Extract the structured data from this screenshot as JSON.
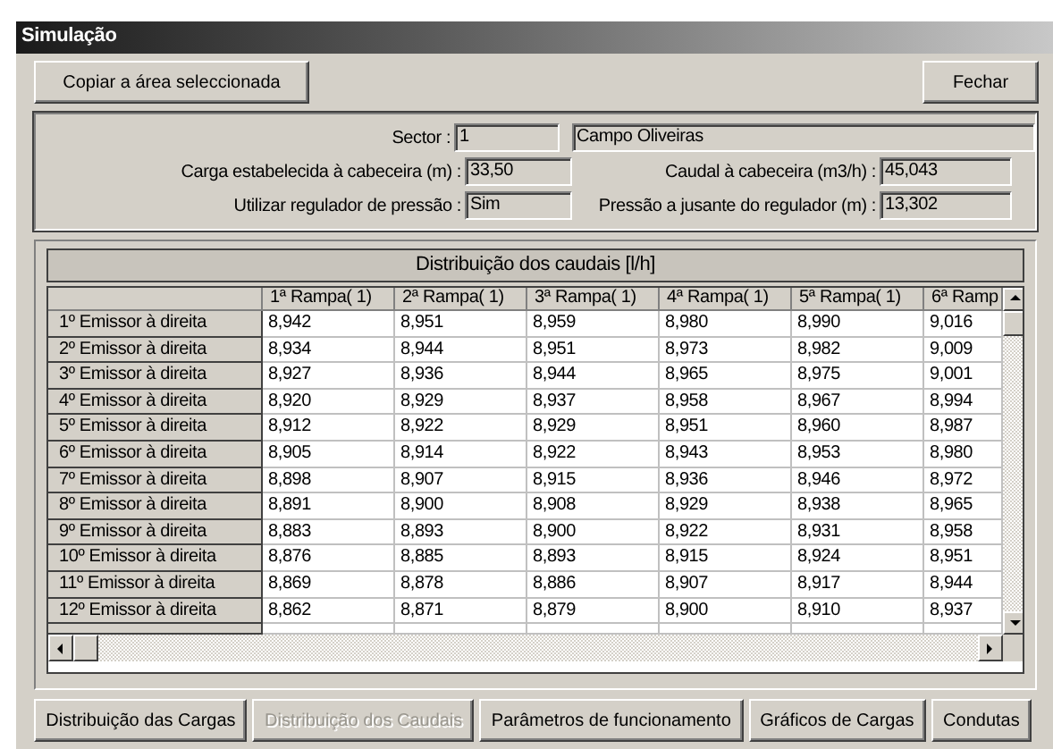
{
  "window": {
    "title": "Simulação"
  },
  "top_buttons": [
    {
      "label": "Copiar a área seleccionada"
    },
    {
      "label": "Fechar"
    }
  ],
  "info": {
    "sector_label": "Sector :",
    "sector_value": "1",
    "sector_name": "Campo Oliveiras",
    "left": [
      {
        "label": "Carga estabelecida à cabeceira (m) :",
        "value": "33,50"
      },
      {
        "label": "Utilizar regulador de pressão :",
        "value": "Sim"
      }
    ],
    "right": [
      {
        "label": "Caudal à cabeceira (m3/h) :",
        "value": "45,043"
      },
      {
        "label": "Pressão a jusante do regulador (m) :",
        "value": "13,302"
      }
    ]
  },
  "table": {
    "title": "Distribuição dos caudais [l/h]",
    "columns": [
      "1ª Rampa( 1)",
      "2ª Rampa( 1)",
      "3ª Rampa( 1)",
      "4ª Rampa( 1)",
      "5ª Rampa( 1)",
      "6ª Ramp"
    ],
    "rows": [
      {
        "label": "1º Emissor à direita",
        "cells": [
          "8,942",
          "8,951",
          "8,959",
          "8,980",
          "8,990",
          "9,016"
        ]
      },
      {
        "label": "2º Emissor à direita",
        "cells": [
          "8,934",
          "8,944",
          "8,951",
          "8,973",
          "8,982",
          "9,009"
        ]
      },
      {
        "label": "3º Emissor à direita",
        "cells": [
          "8,927",
          "8,936",
          "8,944",
          "8,965",
          "8,975",
          "9,001"
        ]
      },
      {
        "label": "4º Emissor à direita",
        "cells": [
          "8,920",
          "8,929",
          "8,937",
          "8,958",
          "8,967",
          "8,994"
        ]
      },
      {
        "label": "5º Emissor à direita",
        "cells": [
          "8,912",
          "8,922",
          "8,929",
          "8,951",
          "8,960",
          "8,987"
        ]
      },
      {
        "label": "6º Emissor à direita",
        "cells": [
          "8,905",
          "8,914",
          "8,922",
          "8,943",
          "8,953",
          "8,980"
        ]
      },
      {
        "label": "7º Emissor à direita",
        "cells": [
          "8,898",
          "8,907",
          "8,915",
          "8,936",
          "8,946",
          "8,972"
        ]
      },
      {
        "label": "8º Emissor à direita",
        "cells": [
          "8,891",
          "8,900",
          "8,908",
          "8,929",
          "8,938",
          "8,965"
        ]
      },
      {
        "label": "9º Emissor à direita",
        "cells": [
          "8,883",
          "8,893",
          "8,900",
          "8,922",
          "8,931",
          "8,958"
        ]
      },
      {
        "label": "10º Emissor à direita",
        "cells": [
          "8,876",
          "8,885",
          "8,893",
          "8,915",
          "8,924",
          "8,951"
        ]
      },
      {
        "label": "11º Emissor à direita",
        "cells": [
          "8,869",
          "8,878",
          "8,886",
          "8,907",
          "8,917",
          "8,944"
        ]
      },
      {
        "label": "12º Emissor à direita",
        "cells": [
          "8,862",
          "8,871",
          "8,879",
          "8,900",
          "8,910",
          "8,937"
        ]
      }
    ]
  },
  "bottom_buttons": [
    {
      "label": "Distribuição das Cargas",
      "disabled": false
    },
    {
      "label": "Distribuição dos Caudais",
      "disabled": true
    },
    {
      "label": "Parâmetros de funcionamento",
      "disabled": false
    },
    {
      "label": "Gráficos de Cargas",
      "disabled": false
    },
    {
      "label": "Condutas",
      "disabled": false
    }
  ]
}
